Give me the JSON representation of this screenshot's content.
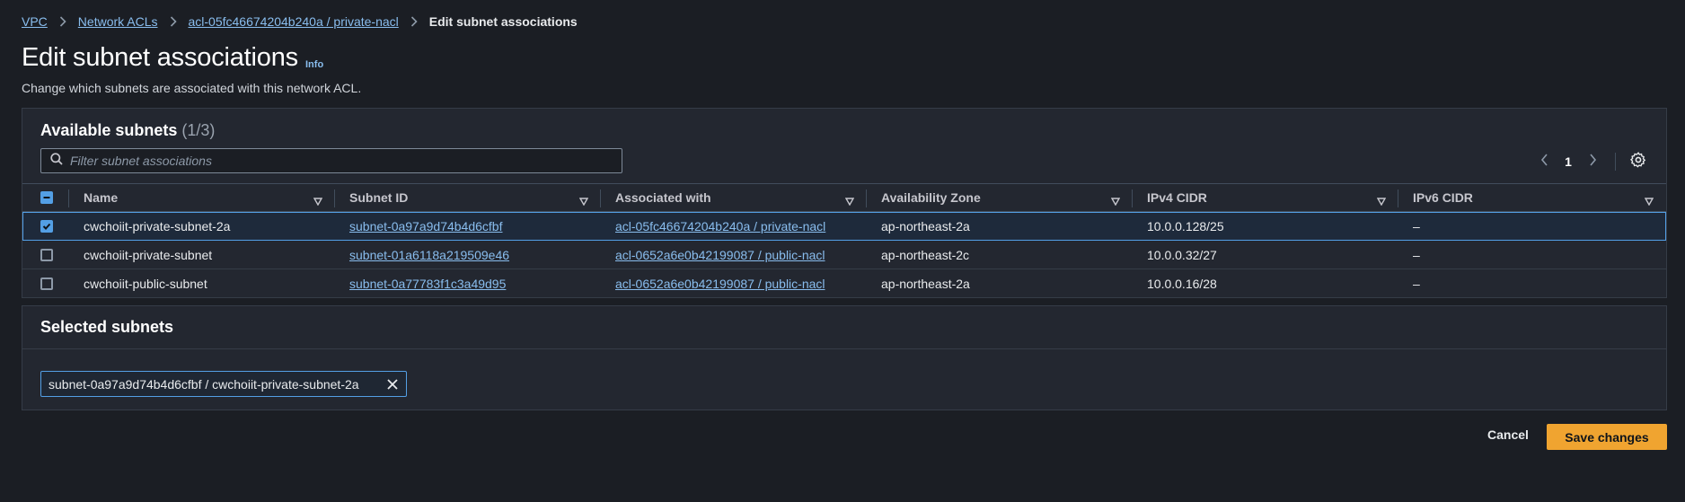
{
  "breadcrumb": [
    {
      "label": "VPC"
    },
    {
      "label": "Network ACLs"
    },
    {
      "label": "acl-05fc46674204b240a / private-nacl"
    },
    {
      "label": "Edit subnet associations"
    }
  ],
  "header": {
    "title": "Edit subnet associations",
    "info": "Info",
    "description": "Change which subnets are associated with this network ACL."
  },
  "available": {
    "heading": "Available subnets",
    "count": "(1/3)",
    "filter_placeholder": "Filter subnet associations",
    "filter_value": "",
    "page": "1",
    "columns": [
      "Name",
      "Subnet ID",
      "Associated with",
      "Availability Zone",
      "IPv4 CIDR",
      "IPv6 CIDR"
    ],
    "rows": [
      {
        "checked": true,
        "name": "cwchoiit-private-subnet-2a",
        "subnet_id": "subnet-0a97a9d74b4d6cfbf",
        "associated": "acl-05fc46674204b240a / private-nacl",
        "az": "ap-northeast-2a",
        "ipv4": "10.0.0.128/25",
        "ipv6": "–"
      },
      {
        "checked": false,
        "name": "cwchoiit-private-subnet",
        "subnet_id": "subnet-01a6118a219509e46",
        "associated": "acl-0652a6e0b42199087 / public-nacl",
        "az": "ap-northeast-2c",
        "ipv4": "10.0.0.32/27",
        "ipv6": "–"
      },
      {
        "checked": false,
        "name": "cwchoiit-public-subnet",
        "subnet_id": "subnet-0a77783f1c3a49d95",
        "associated": "acl-0652a6e0b42199087 / public-nacl",
        "az": "ap-northeast-2a",
        "ipv4": "10.0.0.16/28",
        "ipv6": "–"
      }
    ]
  },
  "selected": {
    "heading": "Selected subnets",
    "tokens": [
      "subnet-0a97a9d74b4d6cfbf / cwchoiit-private-subnet-2a"
    ]
  },
  "actions": {
    "cancel": "Cancel",
    "save": "Save changes"
  },
  "colors": {
    "background": "#1b1e24",
    "panel": "#232730",
    "link": "#89bdee",
    "accent": "#539fe5",
    "primary_button": "#f0a430"
  }
}
